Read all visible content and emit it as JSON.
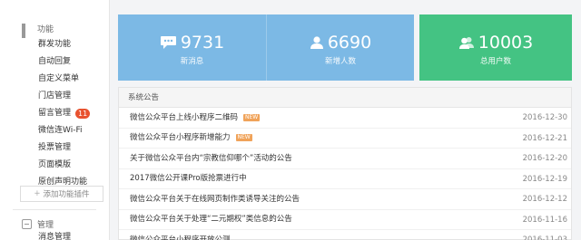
{
  "sidebar": {
    "section1": {
      "label": "功能",
      "icon": "grid-icon"
    },
    "items": [
      {
        "label": "群发功能"
      },
      {
        "label": "自动回复"
      },
      {
        "label": "自定义菜单"
      },
      {
        "label": "门店管理"
      },
      {
        "label": "留言管理",
        "badge": "11"
      },
      {
        "label": "微信连Wi-Fi"
      },
      {
        "label": "投票管理"
      },
      {
        "label": "页面模版"
      },
      {
        "label": "原创声明功能"
      }
    ],
    "add_plugin": {
      "plus": "+",
      "label": "添加功能插件"
    },
    "section2": {
      "label": "管理",
      "icon": "inbox-icon"
    },
    "items2": [
      {
        "label": "消息管理"
      }
    ]
  },
  "stats": [
    {
      "value": "9731",
      "label": "新消息",
      "icon": "chat-icon",
      "color": "#7cb9e5"
    },
    {
      "value": "6690",
      "label": "新增人数",
      "icon": "person-icon",
      "color": "#7cb9e5"
    },
    {
      "value": "10003",
      "label": "总用户数",
      "icon": "users-icon",
      "color": "#44c383"
    }
  ],
  "notices": {
    "title": "系统公告",
    "new_tag": "NEW",
    "items": [
      {
        "text": "微信公众平台上线小程序二维码",
        "date": "2016-12-30",
        "new": true
      },
      {
        "text": "微信公众平台小程序新增能力",
        "date": "2016-12-21",
        "new": true
      },
      {
        "text": "关于微信公众平台内“宗教信仰哪个”活动的公告",
        "date": "2016-12-20",
        "new": false
      },
      {
        "text": "2017微信公开课Pro版抢票进行中",
        "date": "2016-12-19",
        "new": false
      },
      {
        "text": "微信公众平台关于在线网页制作类诱导关注的公告",
        "date": "2016-12-12",
        "new": false
      },
      {
        "text": "微信公众平台关于处理“二元期权”类信息的公告",
        "date": "2016-11-16",
        "new": false
      },
      {
        "text": "微信公众平台小程序开放公测",
        "date": "2016-11-03",
        "new": false
      }
    ]
  }
}
